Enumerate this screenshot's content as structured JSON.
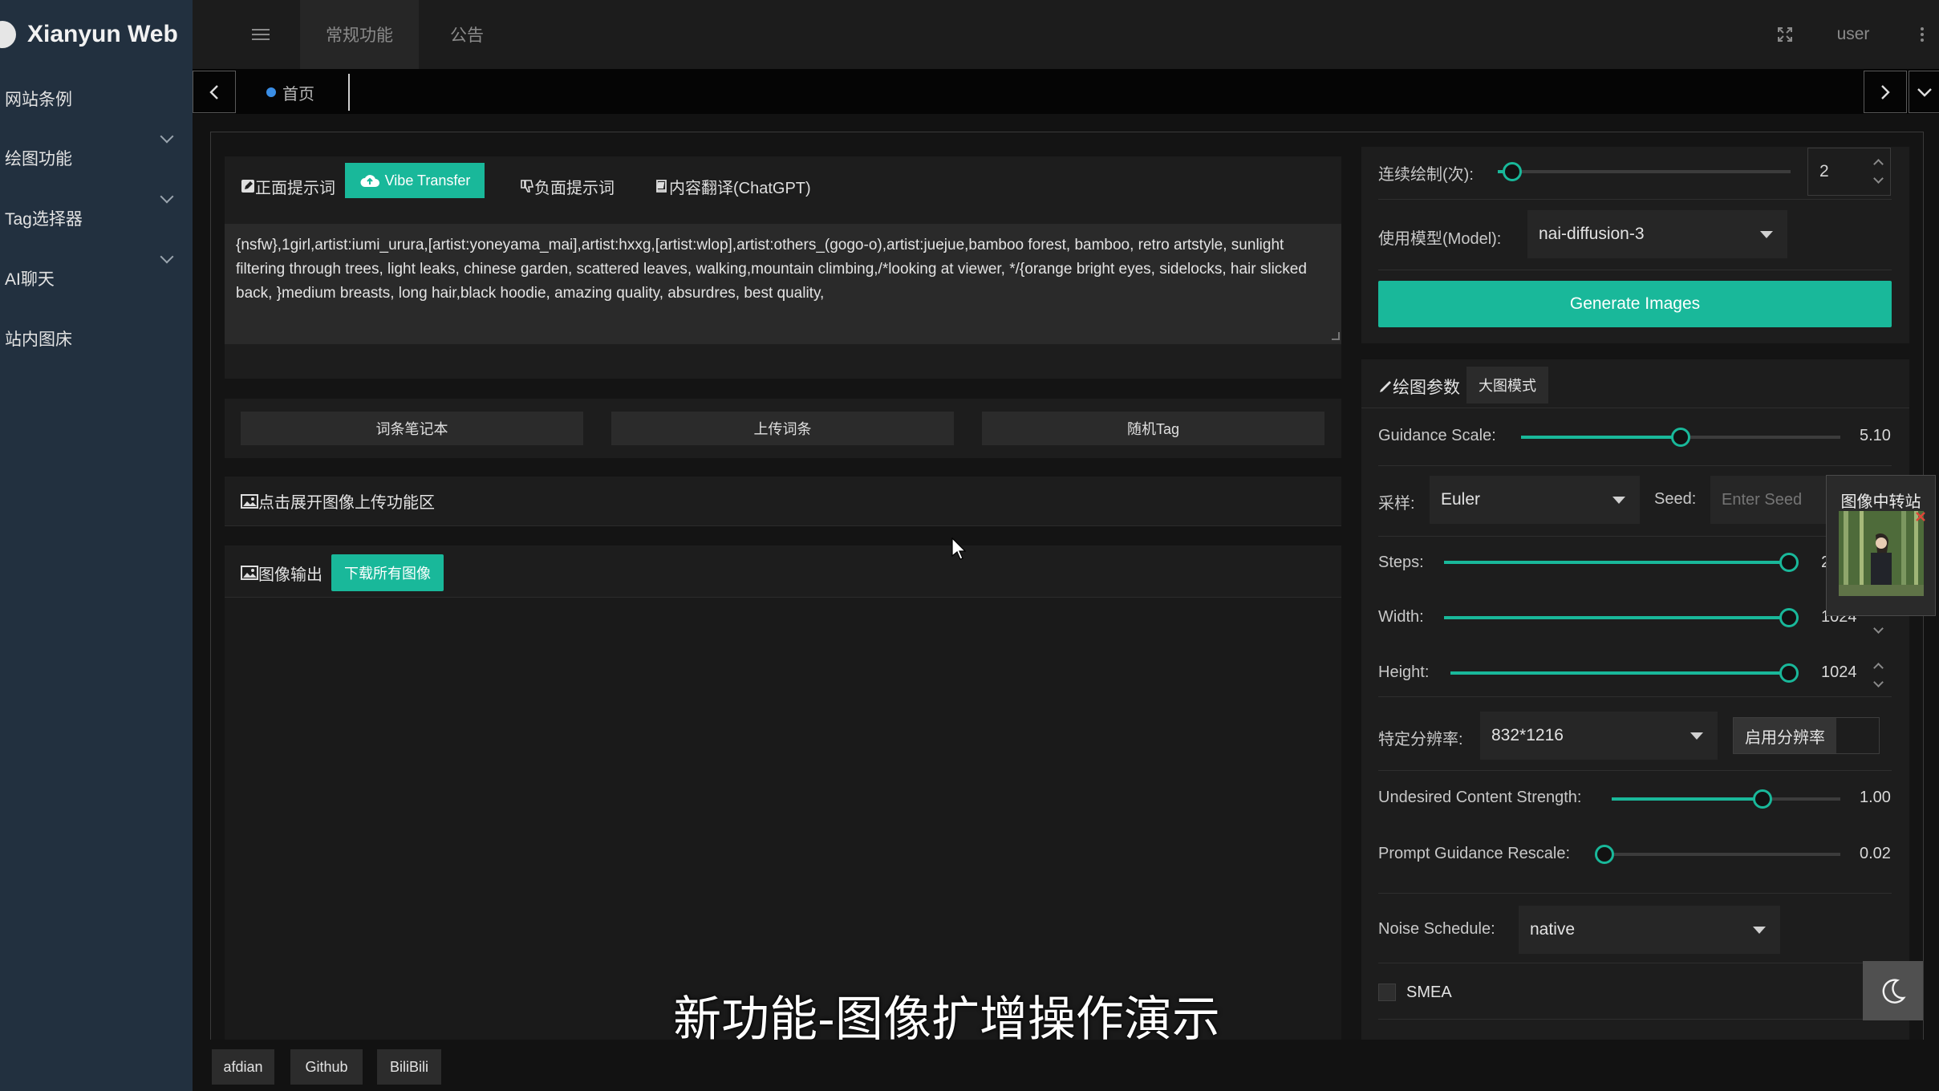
{
  "brand": {
    "name": "Xianyun Web"
  },
  "sidebar": {
    "items": [
      {
        "label": "网站条例"
      },
      {
        "label": "绘图功能"
      },
      {
        "label": "Tag选择器"
      },
      {
        "label": "AI聊天"
      },
      {
        "label": "站内图床"
      }
    ]
  },
  "topbar": {
    "tabs": [
      "常规功能",
      "公告"
    ],
    "user": "user"
  },
  "tags": {
    "home": "首页"
  },
  "prompt": {
    "tab_positive": "正面提示词",
    "tab_vibe": "Vibe Transfer",
    "tab_negative": "负面提示词",
    "tab_translate": "内容翻译(ChatGPT)",
    "text": "{nsfw},1girl,artist:iumi_urura,[artist:yoneyama_mai],artist:hxxg,[artist:wlop],artist:others_(gogo-o),artist:juejue,bamboo forest, bamboo, retro artstyle, sunlight filtering through trees, light leaks, chinese garden, scattered leaves, walking,mountain climbing,/*looking at viewer, */{orange bright eyes, sidelocks, hair slicked back, }medium breasts, long hair,black hoodie, amazing quality, absurdres, best quality,"
  },
  "actions": {
    "notebook": "词条笔记本",
    "upload_words": "上传词条",
    "random_tag": "随机Tag"
  },
  "image_upload": {
    "label": "点击展开图像上传功能区"
  },
  "output": {
    "label": "图像输出",
    "download_all": "下载所有图像"
  },
  "right": {
    "repeat_label": "连续绘制(次):",
    "repeat_value": "2",
    "repeat_fraction": 0.05,
    "model_label": "使用模型(Model):",
    "model_value": "nai-diffusion-3",
    "generate": "Generate Images",
    "params_label": "绘图参数",
    "bigmode": "大图模式",
    "guidance_label": "Guidance Scale:",
    "guidance_value": "5.10",
    "guidance_fraction": 0.5,
    "sampler_label": "采样:",
    "sampler_value": "Euler",
    "seed_label": "Seed:",
    "seed_placeholder": "Enter Seed",
    "steps_label": "Steps:",
    "steps_value": "2",
    "steps_fraction": 1.0,
    "width_label": "Width:",
    "width_value": "1024",
    "width_fraction": 1.0,
    "height_label": "Height:",
    "height_value": "1024",
    "height_fraction": 1.0,
    "res_label": "特定分辨率:",
    "res_value": "832*1216",
    "res_toggle": "启用分辨率",
    "undesired_label": "Undesired Content Strength:",
    "undesired_value": "1.00",
    "undesired_fraction": 0.66,
    "rescale_label": "Prompt Guidance Rescale:",
    "rescale_value": "0.02",
    "rescale_fraction": 0.0,
    "noise_label": "Noise Schedule:",
    "noise_value": "native",
    "smea_label": "SMEA"
  },
  "floating": {
    "title": "图像中转站"
  },
  "caption": "新功能-图像扩增操作演示",
  "footer": [
    "afdian",
    "Github",
    "BiliBili"
  ],
  "colors": {
    "accent": "#19b89a",
    "sidebar": "#22303f",
    "panel": "#1d1d1d"
  }
}
